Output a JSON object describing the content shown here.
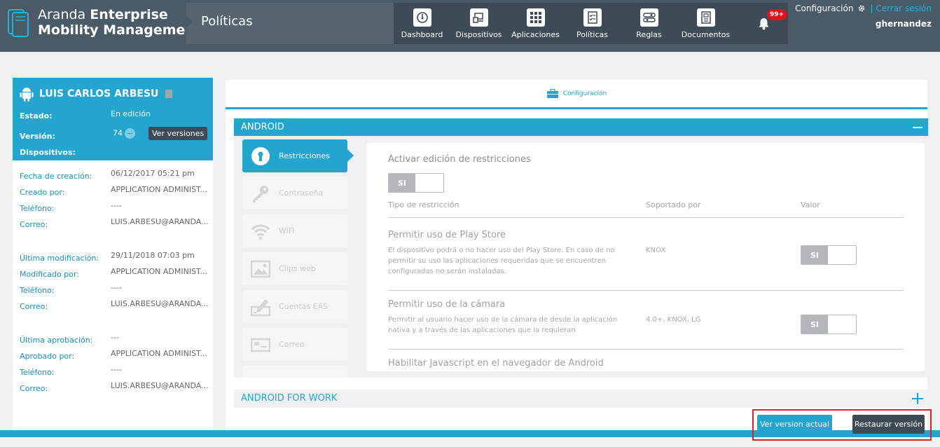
{
  "header": {
    "brand_light": "Aranda",
    "brand_bold": "Enterprise",
    "brand_line2": "Mobility Management",
    "section_title": "Políticas",
    "nav": [
      {
        "label": "Dashboard",
        "icon": "dashboard-icon"
      },
      {
        "label": "Dispositivos",
        "icon": "devices-icon"
      },
      {
        "label": "Aplicaciones",
        "icon": "apps-grid-icon"
      },
      {
        "label": "Políticas",
        "icon": "policies-icon"
      },
      {
        "label": "Reglas",
        "icon": "rules-icon"
      },
      {
        "label": "Documentos",
        "icon": "documents-icon"
      }
    ],
    "notification_count": "99+",
    "config_label": "Configuración",
    "separator": "|",
    "logout_label": "Cerrar sesión",
    "username": "ghernandez"
  },
  "profile": {
    "name": "LUIS CARLOS ARBESU",
    "estado_label": "Estado:",
    "estado_value": "En edición",
    "version_label": "Versión:",
    "version_value": "74",
    "ver_versiones": "Ver versiones",
    "dispositivos_label": "Dispositivos:",
    "creation": [
      {
        "label": "Fecha de creación:",
        "value": "06/12/2017 05:21 pm"
      },
      {
        "label": "Creado por:",
        "value": "APPLICATION ADMINIST..."
      },
      {
        "label": "Teléfono:",
        "value": "----"
      },
      {
        "label": "Correo:",
        "value": "LUIS.ARBESU@ARANDA..."
      }
    ],
    "modification": [
      {
        "label": "Última modificación:",
        "value": "29/11/2018 07:03 pm"
      },
      {
        "label": "Modificado por:",
        "value": "APPLICATION ADMINIST..."
      },
      {
        "label": "Teléfono:",
        "value": "----"
      },
      {
        "label": "Correo:",
        "value": "LUIS.ARBESU@ARANDA..."
      }
    ],
    "approval": [
      {
        "label": "Última aprobación:",
        "value": "---"
      },
      {
        "label": "Aprobado por:",
        "value": "APPLICATION ADMINIST..."
      },
      {
        "label": "Teléfono:",
        "value": "----"
      },
      {
        "label": "Correo:",
        "value": "LUIS.ARBESU@ARANDA..."
      }
    ]
  },
  "main": {
    "config_tab": "Configuración",
    "android_section": "ANDROID",
    "menu": [
      {
        "label": "Restricciones",
        "icon": "keyhole-icon",
        "active": true
      },
      {
        "label": "Contraseña",
        "icon": "key-icon",
        "active": false
      },
      {
        "label": "WiFi",
        "icon": "wifi-icon",
        "active": false
      },
      {
        "label": "Clips web",
        "icon": "image-icon",
        "active": false
      },
      {
        "label": "Cuentas EAS",
        "icon": "signature-icon",
        "active": false
      },
      {
        "label": "Correo",
        "icon": "mail-icon",
        "active": false
      }
    ],
    "restrictions": {
      "title": "Activar edición de restricciones",
      "toggle": "SI",
      "col_type": "Tipo de restricción",
      "col_supported": "Soportado por",
      "col_value": "Valor",
      "items": [
        {
          "title": "Permitir uso de Play Store",
          "desc": "El dispositivo podrá o no hacer uso del Play Store. En caso de no permitir su uso las aplicaciones requeridas que se encuentren configuradas no serán instaladas.",
          "supported": "KNOX",
          "value": "SI"
        },
        {
          "title": "Permitir uso de la cámara",
          "desc": "Permitir al usuario hacer uso de la cámara de desde la aplicación nativa y a través de las aplicaciones que la requieran",
          "supported": "4.0+, KNOX, LG",
          "value": "SI"
        },
        {
          "title": "Habilitar Javascript en el navegador de Android"
        }
      ]
    },
    "android_for_work": "ANDROID FOR WORK"
  },
  "footer": {
    "ver_actual": "Ver version actual",
    "restaurar": "Restaurar versión"
  },
  "colors": {
    "accent": "#23a5cf",
    "header_bg": "#4b5a67",
    "dark_button": "#3e4b57",
    "highlight_frame": "#d8232a",
    "badge": "#e3101d"
  }
}
